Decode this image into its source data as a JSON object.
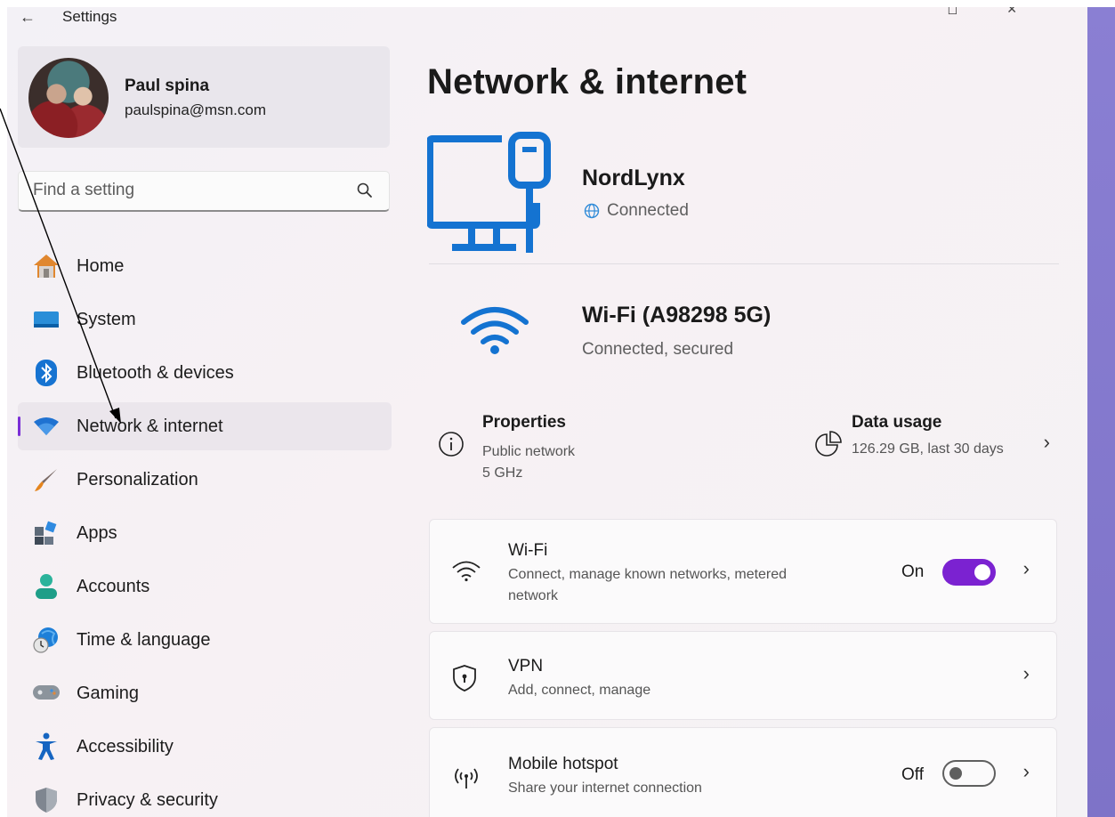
{
  "window": {
    "title": "Settings",
    "back_icon": "back-arrow-icon"
  },
  "profile": {
    "name": "Paul spina",
    "email": "paulspina@msn.com"
  },
  "search": {
    "placeholder": "Find a setting"
  },
  "sidebar": {
    "items": [
      {
        "label": "Home",
        "icon": "home-icon"
      },
      {
        "label": "System",
        "icon": "system-icon"
      },
      {
        "label": "Bluetooth & devices",
        "icon": "bluetooth-icon"
      },
      {
        "label": "Network & internet",
        "icon": "wifi-icon",
        "active": true
      },
      {
        "label": "Personalization",
        "icon": "brush-icon"
      },
      {
        "label": "Apps",
        "icon": "apps-icon"
      },
      {
        "label": "Accounts",
        "icon": "accounts-icon"
      },
      {
        "label": "Time & language",
        "icon": "time-language-icon"
      },
      {
        "label": "Gaming",
        "icon": "gaming-icon"
      },
      {
        "label": "Accessibility",
        "icon": "accessibility-icon"
      },
      {
        "label": "Privacy & security",
        "icon": "shield-icon"
      }
    ]
  },
  "main": {
    "title": "Network & internet",
    "vpn_connection": {
      "name": "NordLynx",
      "status": "Connected"
    },
    "wifi_connection": {
      "name": "Wi-Fi (A98298 5G)",
      "status": "Connected, secured"
    },
    "properties": {
      "title": "Properties",
      "line1": "Public network",
      "line2": "5 GHz"
    },
    "data_usage": {
      "title": "Data usage",
      "value": "126.29 GB, last 30 days"
    },
    "cards": [
      {
        "title": "Wi-Fi",
        "subtitle_line1": "Connect, manage known networks, metered",
        "subtitle_line2": "network",
        "toggle_label": "On",
        "toggle_state": true
      },
      {
        "title": "VPN",
        "subtitle": "Add, connect, manage"
      },
      {
        "title": "Mobile hotspot",
        "subtitle": "Share your internet connection",
        "toggle_label": "Off",
        "toggle_state": false
      }
    ]
  },
  "colors": {
    "accent": "#7b22d1",
    "icon_blue": "#0078d4",
    "window_bg": "#f3f1f6",
    "side_strip": "#8a7fd3"
  }
}
